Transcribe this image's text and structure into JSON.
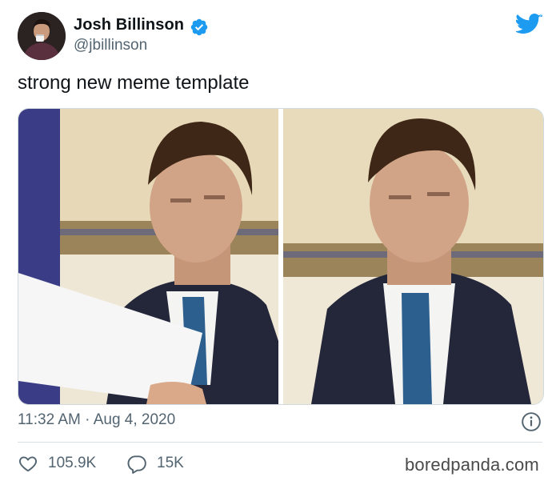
{
  "author": {
    "name": "Josh Billinson",
    "handle": "@jbillinson",
    "verified": true
  },
  "tweet": {
    "text": "strong new meme template",
    "timestamp": "11:32 AM · Aug 4, 2020"
  },
  "media": {
    "images": [
      {
        "label": "Man in suit squinting while reading a white sheet of paper"
      },
      {
        "label": "Same man squinting with a confused expression"
      }
    ]
  },
  "stats": {
    "likes": "105.9K",
    "replies": "15K"
  },
  "watermark": "boredpanda.com",
  "icons": {
    "verified": "verified-badge-icon",
    "brand": "twitter-bird-icon",
    "info": "info-icon",
    "like": "heart-icon",
    "reply": "speech-bubble-icon"
  },
  "colors": {
    "brand": "#1d9bf0",
    "text_primary": "#0f1419",
    "text_secondary": "#536471",
    "border": "#cfd9de"
  }
}
